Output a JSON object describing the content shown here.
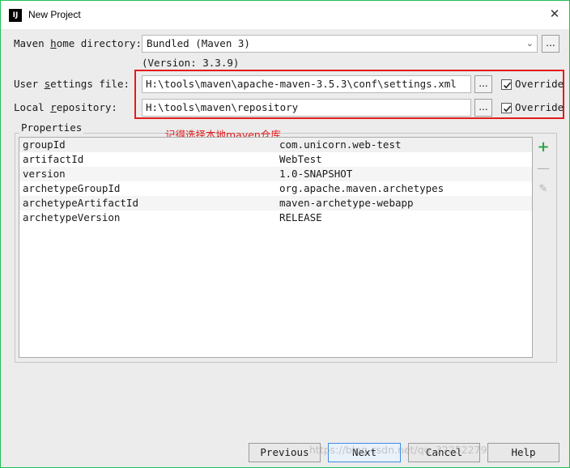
{
  "window": {
    "title": "New Project",
    "app_icon": "IJ"
  },
  "maven": {
    "home_label_pre": "Maven ",
    "home_label_mn": "h",
    "home_label_post": "ome directory:",
    "home_value": "Bundled (Maven 3)",
    "version": "(Version: 3.3.9)",
    "settings_label_pre": "User ",
    "settings_label_mn": "s",
    "settings_label_post": "ettings file:",
    "settings_value": "H:\\tools\\maven\\apache-maven-3.5.3\\conf\\settings.xml",
    "repo_label_pre": "Local ",
    "repo_label_mn": "r",
    "repo_label_post": "epository:",
    "repo_value": "H:\\tools\\maven\\repository",
    "override_label": "Override",
    "browse_label": "..."
  },
  "annotation": "记得选择本地maven仓库",
  "properties": {
    "legend": "Properties",
    "rows": [
      {
        "key": "groupId",
        "value": "com.unicorn.web-test"
      },
      {
        "key": "artifactId",
        "value": "WebTest"
      },
      {
        "key": "version",
        "value": "1.0-SNAPSHOT"
      },
      {
        "key": "archetypeGroupId",
        "value": "org.apache.maven.archetypes"
      },
      {
        "key": "archetypeArtifactId",
        "value": "maven-archetype-webapp"
      },
      {
        "key": "archetypeVersion",
        "value": "RELEASE"
      }
    ]
  },
  "buttons": {
    "previous": "Previous",
    "next": "Next",
    "cancel": "Cancel",
    "help": "Help"
  },
  "watermark": "https://blog.csdn.net/qq_32252279",
  "colors": {
    "accent_border": "#1fbf57",
    "highlight_box": "#e21b1b",
    "add_icon": "#2fa34a"
  }
}
